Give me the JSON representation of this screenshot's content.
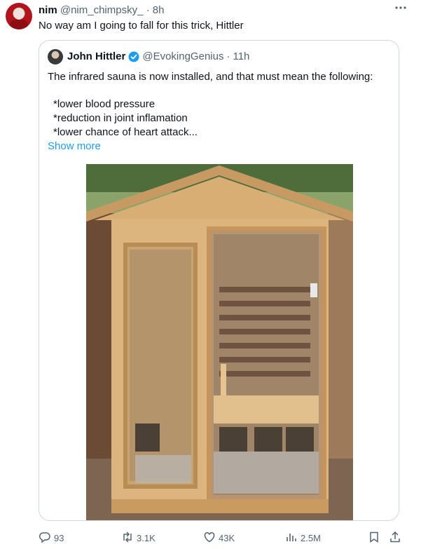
{
  "tweet": {
    "author_name": "nim",
    "handle": "@nim_chimpsky_",
    "separator": "·",
    "time": "8h",
    "text": "No way am I going to fall for this trick, Hittler",
    "more_icon": "more-icon"
  },
  "quoted": {
    "author_name": "John Hittler",
    "handle": "@EvokingGenius",
    "separator": "·",
    "time": "11h",
    "verified": true,
    "text_line": "The infrared sauna is now installed, and that must mean the following:",
    "bullets": [
      "*lower blood pressure",
      "*reduction in joint inflamation",
      "*lower chance of heart attack..."
    ],
    "show_more": "Show more",
    "accent_color": "#1d9bf0"
  },
  "actions": {
    "replies": "93",
    "retweets": "3.1K",
    "likes": "43K",
    "views": "2.5M"
  }
}
